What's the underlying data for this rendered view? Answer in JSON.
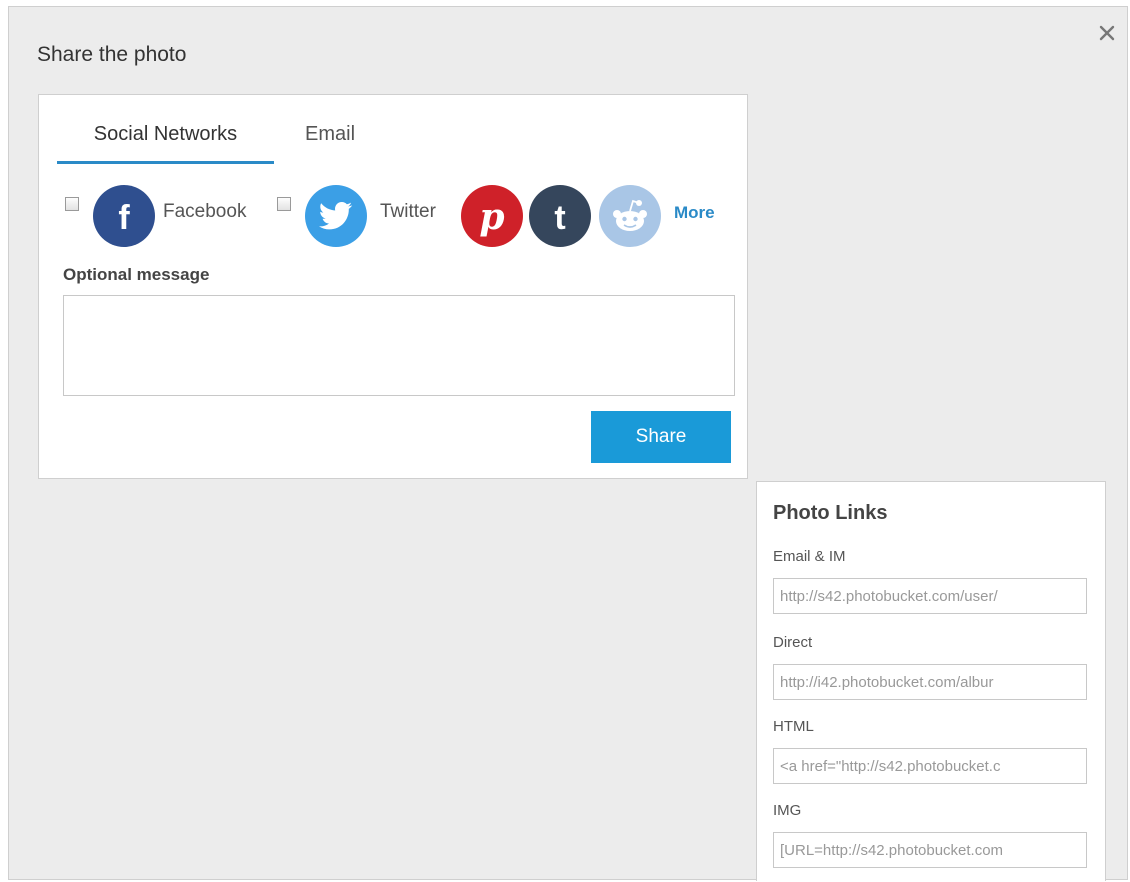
{
  "modal": {
    "title": "Share the photo",
    "close_label": "×"
  },
  "tabs": [
    {
      "label": "Social Networks",
      "active": true
    },
    {
      "label": "Email",
      "active": false
    }
  ],
  "networks": {
    "facebook_label": "Facebook",
    "twitter_label": "Twitter",
    "more_label": "More",
    "icons": {
      "facebook": {
        "glyph": "f",
        "color": "#2f4f8f",
        "icon": "facebook-icon"
      },
      "twitter": {
        "color": "#3b9fe6",
        "icon": "twitter-icon"
      },
      "pinterest": {
        "glyph": "p",
        "color": "#cf2129",
        "icon": "pinterest-icon"
      },
      "tumblr": {
        "glyph": "t",
        "color": "#35465c",
        "icon": "tumblr-icon"
      },
      "reddit": {
        "color": "#a9c6e6",
        "icon": "reddit-icon"
      }
    }
  },
  "message": {
    "label": "Optional message",
    "value": ""
  },
  "share_button": {
    "label": "Share",
    "color": "#1a9ad8"
  },
  "photo_links": {
    "title": "Photo Links",
    "items": [
      {
        "label": "Email & IM",
        "value": "http://s42.photobucket.com/user/"
      },
      {
        "label": "Direct",
        "value": "http://i42.photobucket.com/albur"
      },
      {
        "label": "HTML",
        "value": "<a href=\"http://s42.photobucket.c"
      },
      {
        "label": "IMG",
        "value": "[URL=http://s42.photobucket.com"
      }
    ]
  },
  "colors": {
    "accent": "#2a8ac7",
    "background": "#ececec"
  }
}
